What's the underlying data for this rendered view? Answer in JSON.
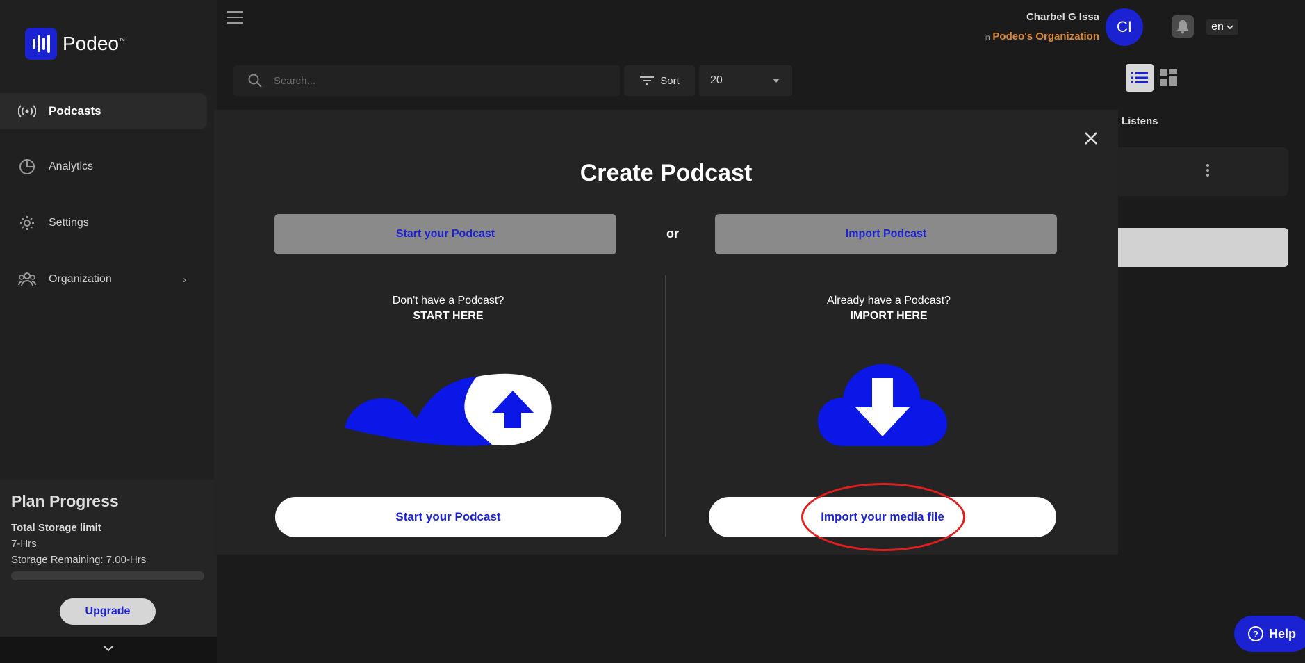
{
  "app": {
    "logo_text": "Podeo",
    "logo_tm": "™"
  },
  "header": {
    "user_name": "Charbel G Issa",
    "org_prefix": "in",
    "org_name": "Podeo's Organization",
    "avatar_initials": "CI",
    "language": "en"
  },
  "sidebar": {
    "items": [
      {
        "label": "Podcasts",
        "icon": "broadcast-icon",
        "active": true
      },
      {
        "label": "Analytics",
        "icon": "pie-chart-icon"
      },
      {
        "label": "Settings",
        "icon": "gear-icon"
      },
      {
        "label": "Organization",
        "icon": "people-icon",
        "chevron": "›"
      }
    ],
    "plan": {
      "title": "Plan Progress",
      "storage_label": "Total Storage limit",
      "storage_value": "7-Hrs",
      "remaining": "Storage Remaining: 7.00-Hrs",
      "progress_fraction": 0,
      "upgrade_label": "Upgrade"
    }
  },
  "toolbar": {
    "search_placeholder": "Search...",
    "sort_label": "Sort",
    "per_page": "20"
  },
  "background": {
    "listens_header": "Listens"
  },
  "modal": {
    "title": "Create Podcast",
    "tab_start": "Start your Podcast",
    "or": "or",
    "tab_import": "Import Podcast",
    "left": {
      "question": "Don't have a Podcast?",
      "action": "START HERE",
      "cta": "Start your Podcast"
    },
    "right": {
      "question": "Already have a Podcast?",
      "action": "IMPORT HERE",
      "cta": "Import your media file"
    }
  },
  "help_label": "Help",
  "help_icon": "?",
  "colors": {
    "accent": "#1b22d1",
    "org": "#d8893a",
    "annotation": "#e01e1e"
  }
}
